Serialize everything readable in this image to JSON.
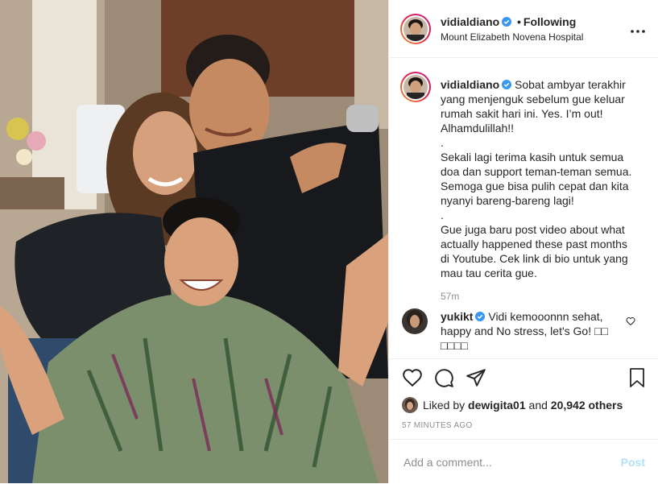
{
  "post": {
    "username": "vidialdiano",
    "follow_status": "Following",
    "separator": "•",
    "location": "Mount Elizabeth Novena Hospital",
    "more_label": "•••"
  },
  "caption": {
    "username": "vidialdiano",
    "lines": [
      "Sobat ambyar terakhir",
      "yang menjenguk sebelum gue keluar",
      "rumah sakit hari ini. Yes. I’m out!",
      "Alhamdulillah!!",
      ".",
      "Sekali lagi terima kasih untuk semua",
      "doa dan support teman-teman semua.",
      "Semoga gue bisa pulih cepat dan kita",
      "nyanyi bareng-bareng lagi!",
      ".",
      "Gue juga baru post video about what",
      "actually happened these past months",
      "di Youtube. Cek link di bio untuk yang",
      "mau tau cerita gue."
    ],
    "time": "57m"
  },
  "comment": {
    "username": "yukikt",
    "line1": "Vidi kemooonnn sehat,",
    "line2": "happy and No stress, let's Go! □□",
    "line3": "□□□□"
  },
  "likes": {
    "prefix": "Liked by",
    "user": "dewigita01",
    "and": "and",
    "count": "20,942 others"
  },
  "timestamp": "57 MINUTES AGO",
  "add_comment": {
    "placeholder": "Add a comment...",
    "post_label": "Post"
  },
  "colors": {
    "verified": "#3897f0",
    "post_button_disabled": "#b2dffc",
    "muted_text": "#8e8e8e"
  }
}
